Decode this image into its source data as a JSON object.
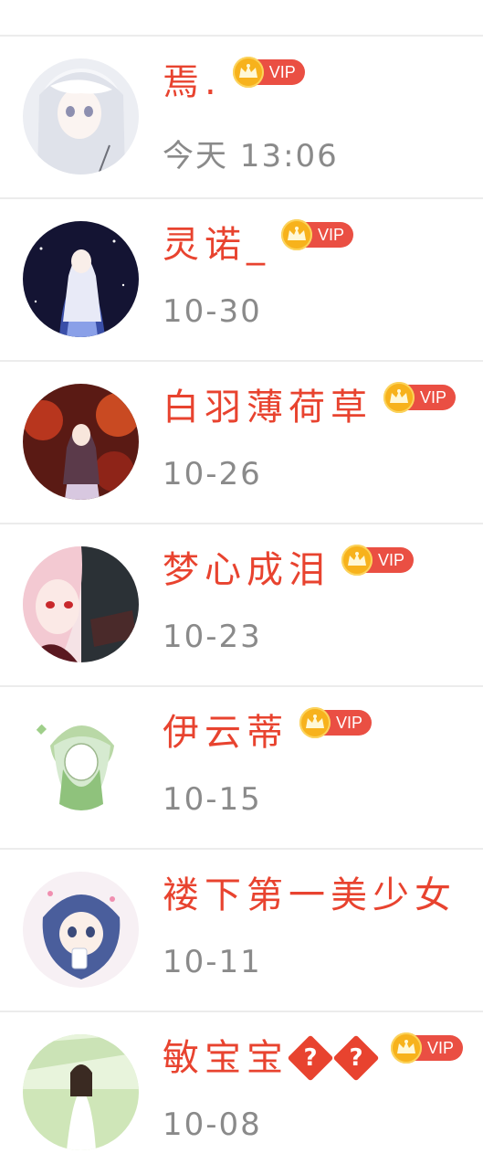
{
  "accent_color": "#e8432f",
  "vip_color": "#ea4f43",
  "crown_color": "#f7b21c",
  "users": [
    {
      "name": "焉.",
      "time": "今天 13:06",
      "vip": true,
      "vip_label": "VIP",
      "avatar": "anime-girl-white-hair-avatar"
    },
    {
      "name": "灵诺_",
      "time": "10-30",
      "vip": true,
      "vip_label": "VIP",
      "avatar": "anime-girl-night-sky-avatar"
    },
    {
      "name": "白羽薄荷草",
      "time": "10-26",
      "vip": true,
      "vip_label": "VIP",
      "avatar": "anime-girl-red-trees-avatar"
    },
    {
      "name": "梦心成泪",
      "time": "10-23",
      "vip": true,
      "vip_label": "VIP",
      "avatar": "anime-girl-pink-hair-avatar"
    },
    {
      "name": "伊云蒂",
      "time": "10-15",
      "vip": true,
      "vip_label": "VIP",
      "avatar": "chibi-girl-green-hood-avatar"
    },
    {
      "name": "褛下第一美少女",
      "time": "10-11",
      "vip": false,
      "vip_label": "",
      "avatar": "chibi-girl-blue-hair-avatar"
    },
    {
      "name": "敏宝宝",
      "name_suffix_glyphs": [
        "?",
        "?"
      ],
      "time": "10-08",
      "vip": true,
      "vip_label": "VIP",
      "avatar": "girl-white-dress-photo-avatar"
    }
  ]
}
